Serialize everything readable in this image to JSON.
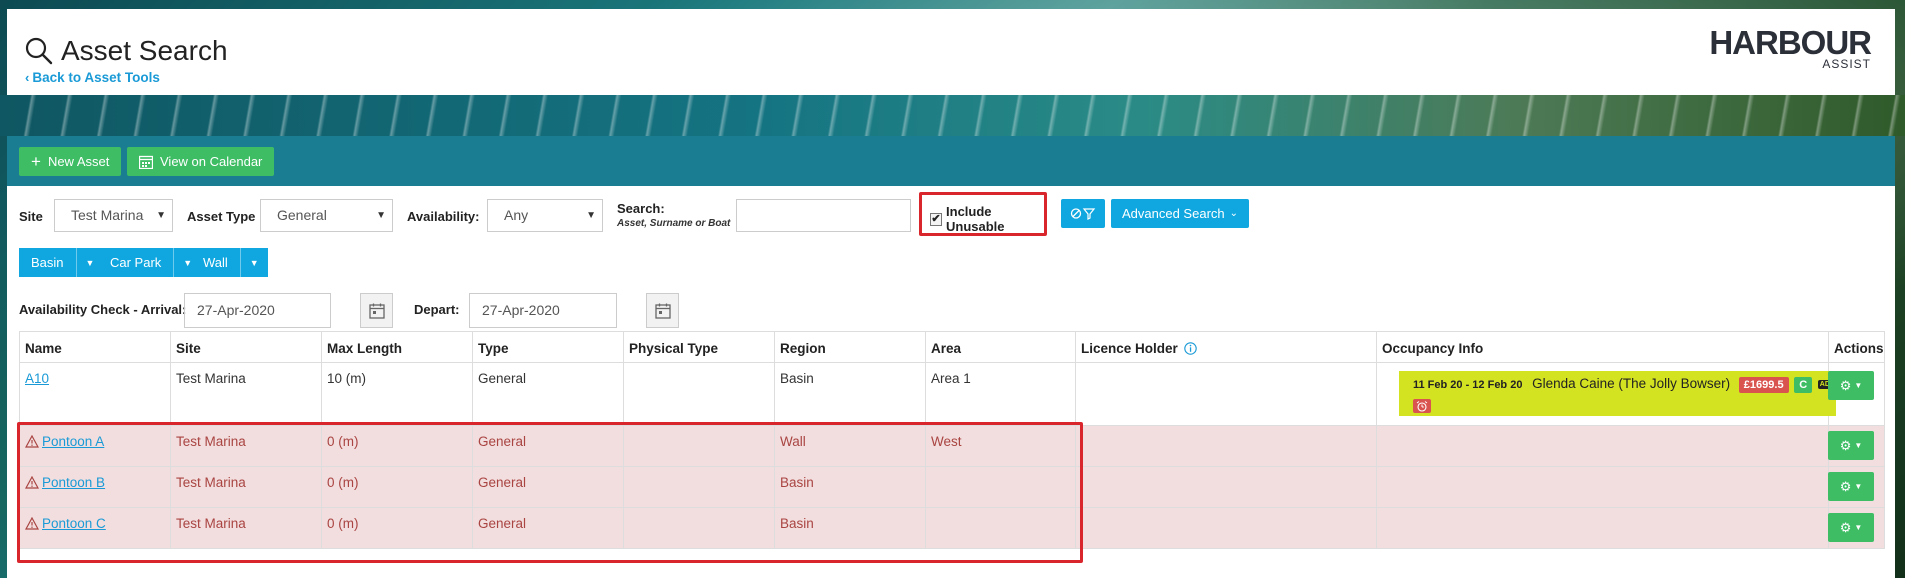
{
  "header": {
    "title": "Asset Search",
    "back_link": "Back to Asset Tools",
    "logo_main": "HARBOUR",
    "logo_sub": "ASSIST"
  },
  "toolbar": {
    "new_asset": "New Asset",
    "view_calendar": "View on Calendar"
  },
  "filters": {
    "site_label": "Site",
    "site_value": "Test Marina",
    "asset_type_label": "Asset Type",
    "asset_type_value": "General",
    "availability_label": "Availability:",
    "availability_value": "Any",
    "search_label": "Search:",
    "search_hint": "Asset, Surname or Boat",
    "search_value": "",
    "include_unusable_label": "Include Unusable",
    "include_unusable_checked": true,
    "advanced_search": "Advanced Search"
  },
  "region_buttons": [
    "Basin",
    "Car Park",
    "Wall"
  ],
  "availability": {
    "arrival_label": "Availability Check - Arrival:",
    "arrival_value": "27-Apr-2020",
    "depart_label": "Depart:",
    "depart_value": "27-Apr-2020"
  },
  "table": {
    "columns": [
      "Name",
      "Site",
      "Max Length",
      "Type",
      "Physical Type",
      "Region",
      "Area",
      "Licence Holder",
      "Occupancy Info",
      "Actions"
    ],
    "rows": [
      {
        "name": "A10",
        "site": "Test Marina",
        "max_length": "10 (m)",
        "type": "General",
        "physical_type": "",
        "region": "Basin",
        "area": "Area 1",
        "licence_holder": "",
        "unusable": false,
        "occupancy": {
          "dates": "11 Feb 20 - 12 Feb 20",
          "who": "Glenda Caine (The Jolly Bowser)",
          "amount": "£1699.5",
          "status": "C",
          "tag": "AD"
        }
      },
      {
        "name": "Pontoon A",
        "site": "Test Marina",
        "max_length": "0 (m)",
        "type": "General",
        "physical_type": "",
        "region": "Wall",
        "area": "West",
        "licence_holder": "",
        "unusable": true
      },
      {
        "name": "Pontoon B",
        "site": "Test Marina",
        "max_length": "0 (m)",
        "type": "General",
        "physical_type": "",
        "region": "Basin",
        "area": "",
        "licence_holder": "",
        "unusable": true
      },
      {
        "name": "Pontoon C",
        "site": "Test Marina",
        "max_length": "0 (m)",
        "type": "General",
        "physical_type": "",
        "region": "Basin",
        "area": "",
        "licence_holder": "",
        "unusable": true
      }
    ]
  },
  "colors": {
    "accent_blue": "#10a7e0",
    "accent_green": "#3ebd65",
    "toolbar_teal": "#1b7d92",
    "unusable_row": "#f2dede",
    "occupancy_yellow": "#d4e321",
    "annotation_red": "#d9262c"
  }
}
